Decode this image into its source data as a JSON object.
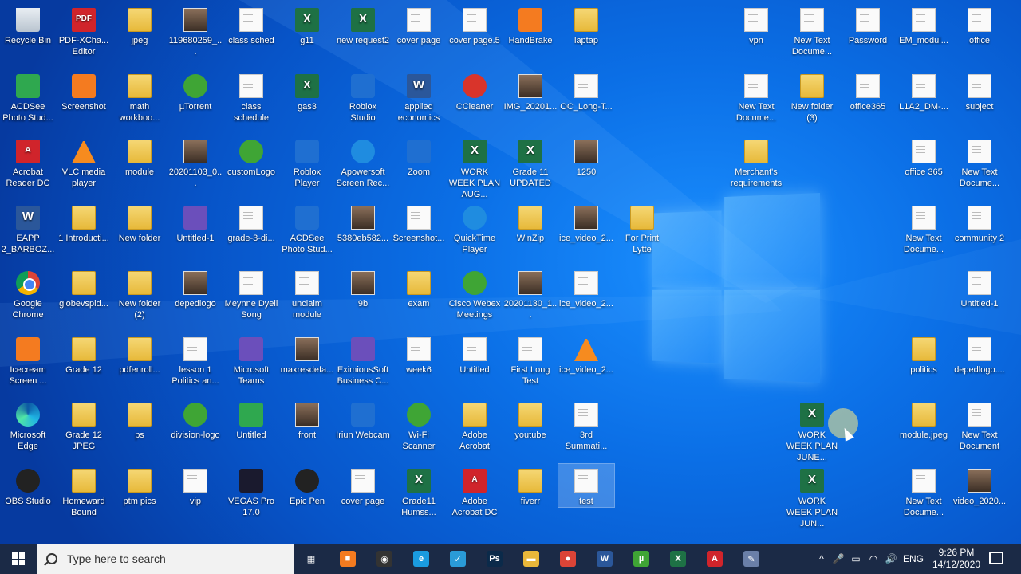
{
  "colors": {
    "wallpaper": "#0b6fe6",
    "taskbar": "#1b2a46"
  },
  "desktop_icons": [
    {
      "label": "Recycle Bin",
      "icon": "recycle-bin-icon",
      "kind": "recycle"
    },
    {
      "label": "PDF-XCha... Editor",
      "icon": "pdf-xchange-icon",
      "kind": "pdf",
      "glyph": "PDF"
    },
    {
      "label": "jpeg",
      "icon": "folder-icon",
      "kind": "folder"
    },
    {
      "label": "119680259_...",
      "icon": "photo-icon",
      "kind": "img"
    },
    {
      "label": "class sched",
      "icon": "image-file-icon",
      "kind": "doc"
    },
    {
      "label": "g11",
      "icon": "excel-icon",
      "kind": "excel",
      "glyph": "X"
    },
    {
      "label": "new request2",
      "icon": "excel-icon",
      "kind": "excel",
      "glyph": "X"
    },
    {
      "label": "cover page",
      "icon": "document-icon",
      "kind": "doc"
    },
    {
      "label": "cover page.5",
      "icon": "document-icon",
      "kind": "doc"
    },
    {
      "label": "HandBrake",
      "icon": "handbrake-icon",
      "kind": "orange"
    },
    {
      "label": "laptap",
      "icon": "folder-icon",
      "kind": "folder"
    },
    {
      "label": "ACDSee Photo Stud...",
      "icon": "acdsee-icon",
      "kind": "green-sq"
    },
    {
      "label": "Screenshot",
      "icon": "screenshot-icon",
      "kind": "orange"
    },
    {
      "label": "math workboo...",
      "icon": "folder-icon",
      "kind": "folder"
    },
    {
      "label": "µTorrent",
      "icon": "utorrent-icon",
      "kind": "green"
    },
    {
      "label": "class schedule",
      "icon": "document-icon",
      "kind": "doc"
    },
    {
      "label": "gas3",
      "icon": "excel-icon",
      "kind": "excel",
      "glyph": "X"
    },
    {
      "label": "Roblox Studio",
      "icon": "roblox-studio-icon",
      "kind": "blue"
    },
    {
      "label": "applied economics",
      "icon": "word-icon",
      "kind": "word",
      "glyph": "W"
    },
    {
      "label": "CCleaner",
      "icon": "ccleaner-icon",
      "kind": "red-round"
    },
    {
      "label": "IMG_20201...",
      "icon": "photo-icon",
      "kind": "img"
    },
    {
      "label": "OC_Long-T...",
      "icon": "document-icon",
      "kind": "doc"
    },
    {
      "label": "Acrobat Reader DC",
      "icon": "acrobat-icon",
      "kind": "pdf",
      "glyph": "A"
    },
    {
      "label": "VLC media player",
      "icon": "vlc-icon",
      "kind": "vlc"
    },
    {
      "label": "module",
      "icon": "folder-icon",
      "kind": "folder"
    },
    {
      "label": "20201103_0...",
      "icon": "photo-icon",
      "kind": "img"
    },
    {
      "label": "customLogo",
      "icon": "logo-icon",
      "kind": "green"
    },
    {
      "label": "Roblox Player",
      "icon": "roblox-player-icon",
      "kind": "blue"
    },
    {
      "label": "Apowersoft Screen Rec...",
      "icon": "apowersoft-icon",
      "kind": "blue-round"
    },
    {
      "label": "Zoom",
      "icon": "zoom-icon",
      "kind": "blue"
    },
    {
      "label": "WORK WEEK PLAN AUG...",
      "icon": "excel-icon",
      "kind": "excel",
      "glyph": "X"
    },
    {
      "label": "Grade 11 UPDATED",
      "icon": "excel-icon",
      "kind": "excel",
      "glyph": "X"
    },
    {
      "label": "1250",
      "icon": "photo-icon",
      "kind": "img"
    },
    {
      "label": "EAPP 2_BARBOZ...",
      "icon": "word-icon",
      "kind": "word",
      "glyph": "W"
    },
    {
      "label": "1 Introducti...",
      "icon": "archive-icon",
      "kind": "folder"
    },
    {
      "label": "New folder",
      "icon": "folder-icon",
      "kind": "folder"
    },
    {
      "label": "Untitled-1",
      "icon": "image-file-icon",
      "kind": "purple"
    },
    {
      "label": "grade-3-di...",
      "icon": "document-icon",
      "kind": "doc"
    },
    {
      "label": "ACDSee Photo Stud...",
      "icon": "acdsee-icon",
      "kind": "blue"
    },
    {
      "label": "5380eb582...",
      "icon": "photo-icon",
      "kind": "img"
    },
    {
      "label": "Screenshot...",
      "icon": "document-icon",
      "kind": "doc"
    },
    {
      "label": "QuickTime Player",
      "icon": "quicktime-icon",
      "kind": "blue-round"
    },
    {
      "label": "WinZip",
      "icon": "winzip-icon",
      "kind": "folder"
    },
    {
      "label": "ice_video_2...",
      "icon": "video-icon",
      "kind": "img"
    },
    {
      "label": "For Print Lytte",
      "icon": "archive-icon",
      "kind": "folder"
    },
    {
      "label": "Google Chrome",
      "icon": "chrome-icon",
      "kind": "chrome"
    },
    {
      "label": "globevspld...",
      "icon": "archive-icon",
      "kind": "folder"
    },
    {
      "label": "New folder (2)",
      "icon": "folder-icon",
      "kind": "folder"
    },
    {
      "label": "depedlogo",
      "icon": "photo-icon",
      "kind": "img"
    },
    {
      "label": "Meynne Dyell Song",
      "icon": "audio-icon",
      "kind": "doc"
    },
    {
      "label": "unclaim module",
      "icon": "document-icon",
      "kind": "doc"
    },
    {
      "label": "9b",
      "icon": "photo-icon",
      "kind": "img"
    },
    {
      "label": "exam",
      "icon": "folder-icon",
      "kind": "folder"
    },
    {
      "label": "Cisco Webex Meetings",
      "icon": "webex-icon",
      "kind": "green"
    },
    {
      "label": "20201130_1...",
      "icon": "photo-icon",
      "kind": "img"
    },
    {
      "label": "ice_video_2...",
      "icon": "video-icon",
      "kind": "doc"
    },
    {
      "label": "Icecream Screen ...",
      "icon": "icecream-icon",
      "kind": "orange"
    },
    {
      "label": "Grade 12",
      "icon": "archive-icon",
      "kind": "folder"
    },
    {
      "label": "pdfenroll...",
      "icon": "folder-icon",
      "kind": "folder"
    },
    {
      "label": "lesson 1 Politics an...",
      "icon": "document-icon",
      "kind": "doc"
    },
    {
      "label": "Microsoft Teams",
      "icon": "teams-icon",
      "kind": "purple"
    },
    {
      "label": "maxresdefa...",
      "icon": "photo-icon",
      "kind": "img"
    },
    {
      "label": "EximiousSoft Business C...",
      "icon": "eximioussoft-icon",
      "kind": "purple"
    },
    {
      "label": "week6",
      "icon": "document-icon",
      "kind": "doc"
    },
    {
      "label": "Untitled",
      "icon": "image-file-icon",
      "kind": "doc"
    },
    {
      "label": "First Long Test",
      "icon": "document-icon",
      "kind": "doc"
    },
    {
      "label": "ice_video_2...",
      "icon": "vlc-icon",
      "kind": "vlc"
    },
    {
      "label": "Microsoft Edge",
      "icon": "edge-icon",
      "kind": "edge"
    },
    {
      "label": "Grade 12 JPEG",
      "icon": "archive-icon",
      "kind": "folder"
    },
    {
      "label": "ps",
      "icon": "folder-icon",
      "kind": "folder"
    },
    {
      "label": "division-logo",
      "icon": "logo-icon",
      "kind": "green"
    },
    {
      "label": "Untitled",
      "icon": "image-file-icon",
      "kind": "green-sq"
    },
    {
      "label": "front",
      "icon": "photo-icon",
      "kind": "img"
    },
    {
      "label": "Iriun Webcam",
      "icon": "webcam-icon",
      "kind": "blue"
    },
    {
      "label": "Wi-Fi Scanner",
      "icon": "wifi-scanner-icon",
      "kind": "green"
    },
    {
      "label": "Adobe Acrobat",
      "icon": "folder-icon",
      "kind": "folder"
    },
    {
      "label": "youtube",
      "icon": "folder-icon",
      "kind": "folder"
    },
    {
      "label": "3rd Summati...",
      "icon": "document-icon",
      "kind": "doc"
    },
    {
      "label": "OBS Studio",
      "icon": "obs-icon",
      "kind": "dark-round"
    },
    {
      "label": "Homeward Bound",
      "icon": "archive-icon",
      "kind": "folder"
    },
    {
      "label": "ptm pics",
      "icon": "folder-icon",
      "kind": "folder"
    },
    {
      "label": "vip",
      "icon": "document-icon",
      "kind": "doc"
    },
    {
      "label": "VEGAS Pro 17.0",
      "icon": "vegas-icon",
      "kind": "dark"
    },
    {
      "label": "Epic Pen",
      "icon": "epic-pen-icon",
      "kind": "dark-round"
    },
    {
      "label": "cover page",
      "icon": "document-icon",
      "kind": "doc"
    },
    {
      "label": "Grade11 Humss...",
      "icon": "excel-icon",
      "kind": "excel",
      "glyph": "X"
    },
    {
      "label": "Adobe Acrobat DC",
      "icon": "acrobat-icon",
      "kind": "pdf",
      "glyph": "A"
    },
    {
      "label": "fiverr",
      "icon": "archive-icon",
      "kind": "folder"
    },
    {
      "label": "test",
      "icon": "document-icon",
      "kind": "doc",
      "selected": true
    },
    {
      "label": "vpn",
      "icon": "text-file-icon",
      "kind": "doc"
    },
    {
      "label": "New Text Docume...",
      "icon": "text-file-icon",
      "kind": "doc"
    },
    {
      "label": "Password",
      "icon": "text-file-icon",
      "kind": "doc"
    },
    {
      "label": "EM_modul...",
      "icon": "document-icon",
      "kind": "doc"
    },
    {
      "label": "office",
      "icon": "image-file-icon",
      "kind": "doc"
    },
    {
      "label": "New Text Docume...",
      "icon": "text-file-icon",
      "kind": "doc"
    },
    {
      "label": "New folder (3)",
      "icon": "folder-icon",
      "kind": "folder"
    },
    {
      "label": "office365",
      "icon": "text-file-icon",
      "kind": "doc"
    },
    {
      "label": "L1A2_DM-...",
      "icon": "document-icon",
      "kind": "doc"
    },
    {
      "label": "subject",
      "icon": "image-file-icon",
      "kind": "doc"
    },
    {
      "label": "Merchant's requirements",
      "icon": "archive-icon",
      "kind": "folder"
    },
    {
      "label": "office 365",
      "icon": "text-file-icon",
      "kind": "doc"
    },
    {
      "label": "New Text Docume...",
      "icon": "text-file-icon",
      "kind": "doc"
    },
    {
      "label": "New Text Docume...",
      "icon": "text-file-icon",
      "kind": "doc"
    },
    {
      "label": "community 2",
      "icon": "document-icon",
      "kind": "doc"
    },
    {
      "label": "Untitled-1",
      "icon": "image-file-icon",
      "kind": "doc"
    },
    {
      "label": "politics",
      "icon": "archive-icon",
      "kind": "folder"
    },
    {
      "label": "depedlogo....",
      "icon": "document-icon",
      "kind": "doc"
    },
    {
      "label": "WORK WEEK PLAN JUNE...",
      "icon": "excel-icon",
      "kind": "excel",
      "glyph": "X"
    },
    {
      "label": "module.jpeg",
      "icon": "folder-icon",
      "kind": "folder"
    },
    {
      "label": "New Text Document",
      "icon": "text-file-icon",
      "kind": "doc"
    },
    {
      "label": "WORK WEEK PLAN JUN...",
      "icon": "excel-icon",
      "kind": "excel",
      "glyph": "X"
    },
    {
      "label": "New Text Docume...",
      "icon": "text-file-icon",
      "kind": "doc"
    },
    {
      "label": "video_2020...",
      "icon": "photo-icon",
      "kind": "img"
    }
  ],
  "taskbar": {
    "search_placeholder": "Type here to search",
    "pinned": [
      {
        "name": "task-view-icon",
        "color": "#1b2a46",
        "glyph": "▦"
      },
      {
        "name": "screenshot-app-icon",
        "color": "#f47b20",
        "glyph": "■"
      },
      {
        "name": "obs-taskbar-icon",
        "color": "#333333",
        "glyph": "◉"
      },
      {
        "name": "edge-taskbar-icon",
        "color": "#1a9be0",
        "glyph": "e"
      },
      {
        "name": "snip-icon",
        "color": "#2a9bd8",
        "glyph": "✓"
      },
      {
        "name": "photoshop-icon",
        "color": "#0b2a4a",
        "glyph": "Ps"
      },
      {
        "name": "file-explorer-icon",
        "color": "#e9b73a",
        "glyph": "▬"
      },
      {
        "name": "chrome-taskbar-icon",
        "color": "#db4437",
        "glyph": "●"
      },
      {
        "name": "word-taskbar-icon",
        "color": "#2b579a",
        "glyph": "W"
      },
      {
        "name": "utorrent-taskbar-icon",
        "color": "#3fa535",
        "glyph": "µ"
      },
      {
        "name": "excel-taskbar-icon",
        "color": "#1e7145",
        "glyph": "X"
      },
      {
        "name": "acrobat-taskbar-icon",
        "color": "#d0242b",
        "glyph": "A"
      },
      {
        "name": "paint-icon",
        "color": "#6a7fa8",
        "glyph": "✎"
      }
    ],
    "tray": {
      "chevron": "^",
      "language": "ENG",
      "time": "9:26 PM",
      "date": "14/12/2020"
    }
  }
}
